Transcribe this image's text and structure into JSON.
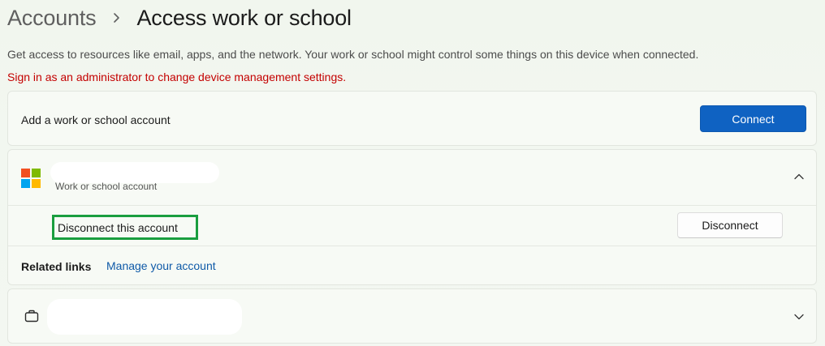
{
  "header": {
    "breadcrumb_parent": "Accounts",
    "breadcrumb_current": "Access work or school"
  },
  "description": "Get access to resources like email, apps, and the network. Your work or school might control some things on this device when connected.",
  "warning": "Sign in as an administrator to change device management settings.",
  "add_account": {
    "label": "Add a work or school account",
    "button_label": "Connect"
  },
  "account": {
    "subtitle": "Work or school account",
    "expanded": true,
    "disconnect_label": "Disconnect this account",
    "disconnect_button": "Disconnect",
    "related_links_label": "Related links",
    "manage_link": "Manage your account"
  },
  "second_account": {
    "expanded": false
  },
  "colors": {
    "accent": "#0f62c2",
    "warning": "#c40000",
    "highlight_box": "#1a9e3f",
    "link": "#0f5aa8",
    "ms_logo": [
      "#f25022",
      "#7fba00",
      "#00a4ef",
      "#ffb900"
    ]
  },
  "icons": {
    "breadcrumb_separator": "chevron-right-icon",
    "account_logo": "microsoft-logo-icon",
    "account_toggle": "chevron-up-icon",
    "second_account_logo": "briefcase-icon",
    "second_account_toggle": "chevron-down-icon"
  }
}
